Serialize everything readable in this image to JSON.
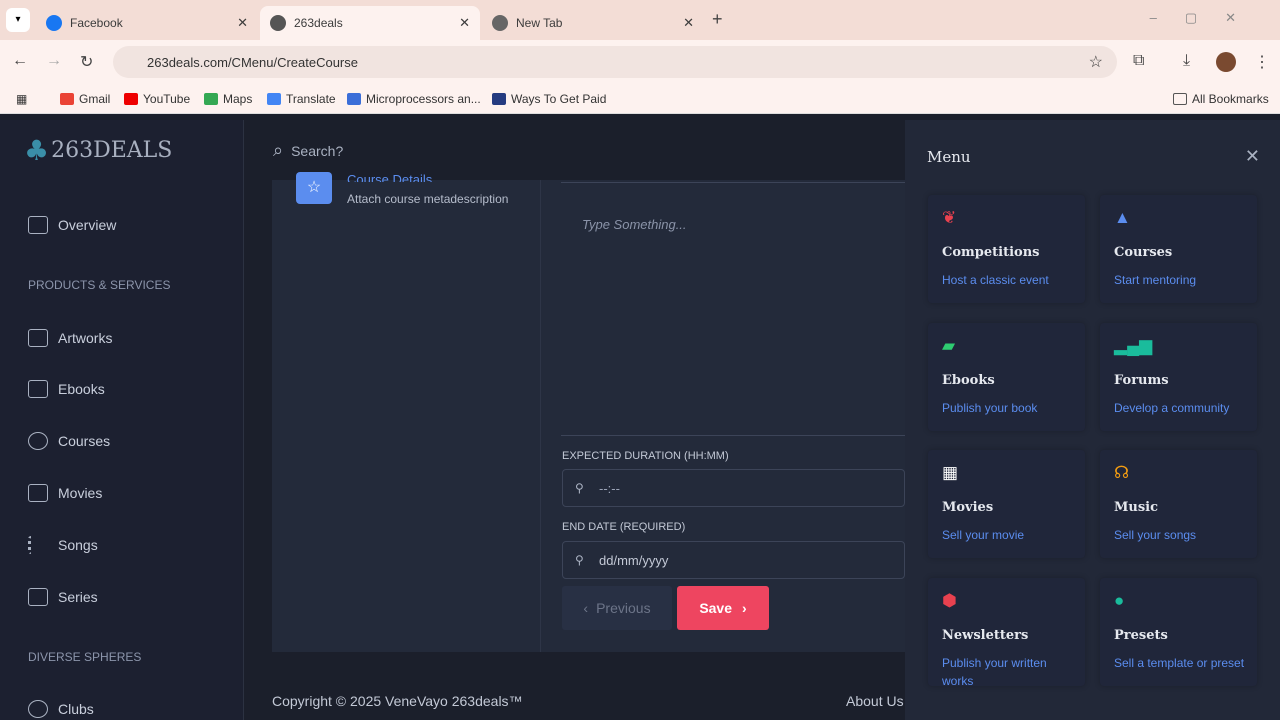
{
  "browser": {
    "tabs": [
      {
        "label": "Facebook"
      },
      {
        "label": "263deals"
      },
      {
        "label": "New Tab"
      }
    ],
    "url": "263deals.com/CMenu/CreateCourse",
    "bookmarks": [
      "Gmail",
      "YouTube",
      "Maps",
      "Translate",
      "Microprocessors an...",
      "Ways To Get Paid"
    ],
    "all_bookmarks": "All Bookmarks"
  },
  "logo": "263DEALS",
  "sidebar": {
    "overview": "Overview",
    "section1": "PRODUCTS & SERVICES",
    "items": [
      "Artworks",
      "Ebooks",
      "Courses",
      "Movies",
      "Songs",
      "Series"
    ],
    "section2": "DIVERSE SPHERES",
    "clubs": "Clubs"
  },
  "search": {
    "placeholder": "Search?"
  },
  "step": {
    "title": "Course Details",
    "desc": "Attach course metadescription"
  },
  "editor": {
    "placeholder": "Type Something..."
  },
  "form": {
    "duration_label": "EXPECTED DURATION (HH:MM)",
    "duration_value": "--:--",
    "end_label": "END DATE (REQUIRED)",
    "end_value": "dd/mm/yyyy",
    "prev": "Previous",
    "save": "Save"
  },
  "footer": {
    "copyright": "Copyright © 2025 VeneVayo 263deals™",
    "about": "About Us"
  },
  "menu": {
    "title": "Menu",
    "items": [
      {
        "title": "Competitions",
        "sub": "Host a classic event",
        "color": "#e8414f"
      },
      {
        "title": "Courses",
        "sub": "Start mentoring",
        "color": "#5b8def"
      },
      {
        "title": "Ebooks",
        "sub": "Publish your book",
        "color": "#2ecc71"
      },
      {
        "title": "Forums",
        "sub": "Develop a community",
        "color": "#1abc9c"
      },
      {
        "title": "Movies",
        "sub": "Sell your movie",
        "color": "#ffffff"
      },
      {
        "title": "Music",
        "sub": "Sell your songs",
        "color": "#f39c12"
      },
      {
        "title": "Newsletters",
        "sub": "Publish your written works",
        "color": "#e8414f"
      },
      {
        "title": "Presets",
        "sub": "Sell a template or preset",
        "color": "#1abc9c"
      }
    ]
  }
}
